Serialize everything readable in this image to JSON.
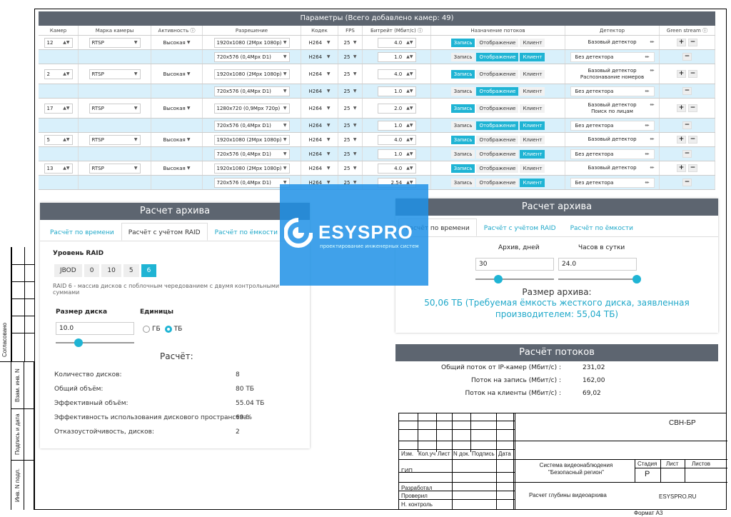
{
  "params": {
    "title": "Параметры  (Всего добавлено камер: 49)",
    "headers": [
      "Камер",
      "Марка камеры",
      "Активность",
      "Разрешение",
      "Кодек",
      "FPS",
      "Битрейт (Мбит/с)",
      "Назначение потоков",
      "Детектор",
      "Green stream"
    ],
    "info_icon": "info-circle-icon",
    "toggle_labels": [
      "Запись",
      "Отображение",
      "Клиент"
    ],
    "rows": [
      {
        "cam": "12",
        "brand": "RTSP",
        "activity": "Высокая",
        "res": "1920x1080 (2Mpx 1080p)",
        "codec": "H264",
        "fps": "25",
        "bitrate": "4.0",
        "on": [
          0
        ],
        "det": [
          "Базовый детектор"
        ],
        "green": "+ −"
      },
      {
        "sub": true,
        "res": "720x576 (0,4Mpx D1)",
        "codec": "H264",
        "fps": "25",
        "bitrate": "1.0",
        "on": [
          1,
          2
        ],
        "det": [
          "Без детектора"
        ],
        "green": "−"
      },
      {
        "cam": "2",
        "brand": "RTSP",
        "activity": "Высокая",
        "res": "1920x1080 (2Mpx 1080p)",
        "codec": "H264",
        "fps": "25",
        "bitrate": "4.0",
        "on": [
          0
        ],
        "det": [
          "Базовый детектор",
          "Распознавание номеров"
        ],
        "green": "+ −"
      },
      {
        "sub": true,
        "res": "720x576 (0,4Mpx D1)",
        "codec": "H264",
        "fps": "25",
        "bitrate": "1.0",
        "on": [
          1
        ],
        "det": [
          "Без детектора"
        ],
        "green": "−"
      },
      {
        "cam": "17",
        "brand": "RTSP",
        "activity": "Высокая",
        "res": "1280x720 (0,9Mpx 720p)",
        "codec": "H264",
        "fps": "25",
        "bitrate": "2.0",
        "on": [
          0
        ],
        "det": [
          "Базовый детектор",
          "Поиск по лицам"
        ],
        "green": "+ −"
      },
      {
        "sub": true,
        "res": "720x576 (0,4Mpx D1)",
        "codec": "H264",
        "fps": "25",
        "bitrate": "1.0",
        "on": [
          1,
          2
        ],
        "det": [
          "Без детектора"
        ],
        "green": "−"
      },
      {
        "cam": "5",
        "brand": "RTSP",
        "activity": "Высокая",
        "res": "1920x1080 (2Mpx 1080p)",
        "codec": "H264",
        "fps": "25",
        "bitrate": "4.0",
        "on": [
          0
        ],
        "det": [
          "Базовый детектор"
        ],
        "green": "+ −"
      },
      {
        "sub": true,
        "res": "720x576 (0,4Mpx D1)",
        "codec": "H264",
        "fps": "25",
        "bitrate": "1.0",
        "on": [
          2
        ],
        "det": [
          "Без детектора"
        ],
        "green": "−"
      },
      {
        "cam": "13",
        "brand": "RTSP",
        "activity": "Высокая",
        "res": "1920x1080 (2Mpx 1080p)",
        "codec": "H264",
        "fps": "25",
        "bitrate": "4.0",
        "on": [
          0
        ],
        "det": [
          "Базовый детектор"
        ],
        "green": "+ −"
      },
      {
        "sub": true,
        "res": "720x576 (0,4Mpx D1)",
        "codec": "H264",
        "fps": "25",
        "bitrate": "2.54",
        "on": [
          2
        ],
        "det": [
          "Без детектора"
        ],
        "green": "−"
      }
    ]
  },
  "archive_left": {
    "title": "Расчет архива",
    "tabs": [
      "Расчёт по времени",
      "Расчёт с учётом RAID",
      "Расчёт по ёмкости"
    ],
    "raid_label": "Уровень RAID",
    "raid_options": [
      "JBOD",
      "0",
      "10",
      "5",
      "6"
    ],
    "raid_selected": "6",
    "raid_desc": "RAID 6 - массив дисков с поблочным чередованием с двумя контрольными суммами",
    "disk_size_label": "Размер диска",
    "disk_size_value": "10.0",
    "units_label": "Единицы",
    "unit_gb": "ГБ",
    "unit_tb": "ТБ",
    "calc_title": "Расчёт:",
    "results": [
      {
        "k": "Количество дисков:",
        "v": "8"
      },
      {
        "k": "Общий объём:",
        "v": "80 ТБ"
      },
      {
        "k": "Эффективный объём:",
        "v": "55.04 ТБ"
      },
      {
        "k": "Эффективность использования дискового пространства:",
        "v": "69 %"
      },
      {
        "k": "Отказоустойчивость, дисков:",
        "v": "2"
      }
    ]
  },
  "archive_right": {
    "title": "Расчет архива",
    "tabs": [
      "Расчёт по времени",
      "Расчёт с учётом RAID",
      "Расчёт по ёмкости"
    ],
    "days_label": "Архив, дней",
    "days_value": "30",
    "hours_label": "Часов в сутки",
    "hours_value": "24.0",
    "size_label": "Размер архива:",
    "size_value": "50,06 ТБ (Требуемая ёмкость жесткого диска, заявленная производителем: 55,04 ТБ)"
  },
  "streams": {
    "title": "Расчёт потоков",
    "rows": [
      {
        "k": "Общий поток от IP-камер (Мбит/с) :",
        "v": "231,02"
      },
      {
        "k": "Поток на запись (Мбит/с) :",
        "v": "162,00"
      },
      {
        "k": "Поток на клиенты (Мбит/с) :",
        "v": "69,02"
      }
    ]
  },
  "logo": {
    "name": "ESYSPRO",
    "tagline": "проектирование инженерных систем"
  },
  "side_labels": [
    "Согласовано",
    "Взам. инв. N",
    "Подпись и дата",
    "Инв. N подл."
  ],
  "stamp": {
    "code": "СВН-БР",
    "cols": [
      "Изм.",
      "Кол.уч",
      "Лист",
      "N док.",
      "Подпись",
      "Дата"
    ],
    "roles": [
      "ГИП",
      "Разработал",
      "Проверил",
      "Н. контроль"
    ],
    "system": "Система видеонаблюдения\n\"Безопасный регион\"",
    "stage_label": "Стадия",
    "sheet_label": "Лист",
    "sheets_label": "Листов",
    "stage": "Р",
    "doc_title": "Расчет глубины видеоархива",
    "company": "ESYSPRO.RU",
    "format": "Формат А3"
  },
  "colors": {
    "accent": "#1fb4d4",
    "header": "#5d6570",
    "sub_row": "#d9f0fb",
    "logo": "#1e90e6"
  }
}
